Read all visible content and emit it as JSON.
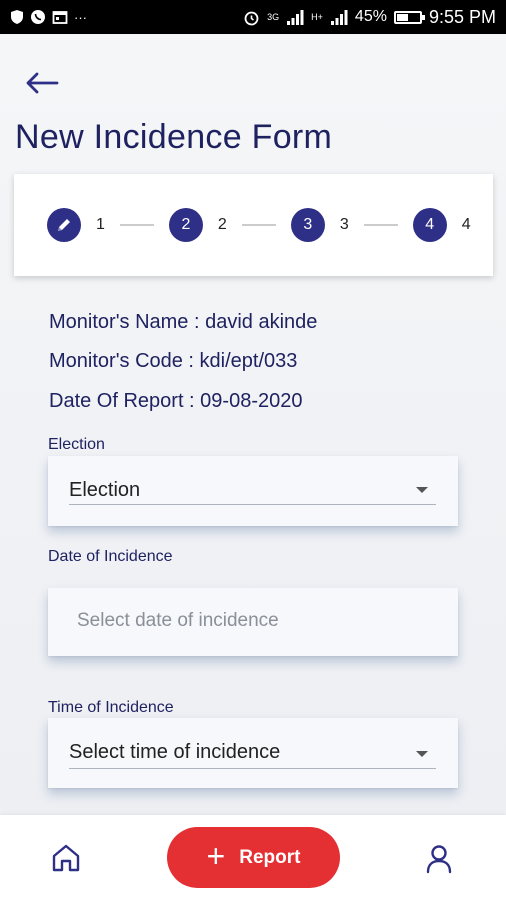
{
  "status_bar": {
    "left_extra": "···",
    "network_1": "3G",
    "network_2": "H+",
    "battery_percent": "45%",
    "battery_level": 0.45,
    "time": "9:55 PM"
  },
  "header": {
    "title": "New Incidence Form"
  },
  "stepper": {
    "steps": [
      {
        "number": "1",
        "circle": "",
        "icon": "pencil-icon"
      },
      {
        "number": "2",
        "circle": "2"
      },
      {
        "number": "3",
        "circle": "3"
      },
      {
        "number": "4",
        "circle": "4"
      }
    ]
  },
  "info": {
    "monitor_name": "Monitor's Name : david akinde",
    "monitor_code": "Monitor's Code : kdi/ept/033",
    "date_of_report": "Date Of Report : 09-08-2020"
  },
  "form": {
    "election": {
      "label": "Election",
      "value": "Election"
    },
    "date_of_incidence": {
      "label": "Date of Incidence",
      "placeholder": "Select date of incidence"
    },
    "time_of_incidence": {
      "label": "Time of Incidence",
      "value": "Select time of incidence"
    }
  },
  "bottom_nav": {
    "home_icon": "home-icon",
    "report_label": "Report",
    "profile_icon": "person-icon"
  },
  "colors": {
    "primary": "#2e2f86",
    "accent": "#e53033",
    "title": "#1f2260"
  }
}
